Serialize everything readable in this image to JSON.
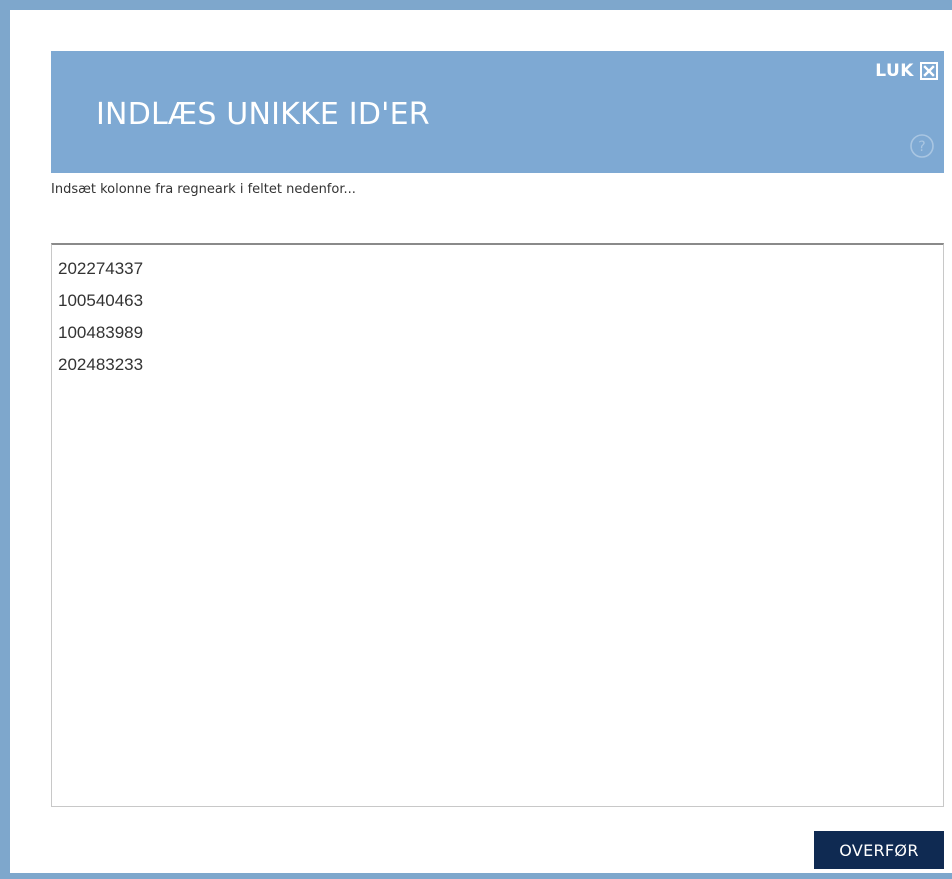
{
  "dialog": {
    "title": "INDLÆS UNIKKE ID'ER",
    "close_label": "LUK",
    "close_icon": "close-box-icon",
    "help_icon": "question-circle-icon",
    "instructions": "Indsæt kolonne fra regneark i feltet nedenfor...",
    "textarea_value": "202274337\n100540463\n100483989\n202483233",
    "submit_label": "OVERFØR"
  },
  "colors": {
    "frame_border": "#7ea7cc",
    "header_background": "#7ea9d3",
    "header_text": "#ffffff",
    "button_background": "#0f2a52",
    "button_text": "#ffffff"
  }
}
